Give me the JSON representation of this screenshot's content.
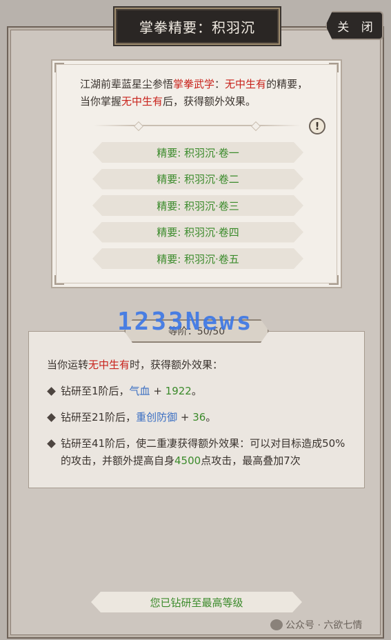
{
  "title": "掌拳精要：积羽沉",
  "close_label": "关 闭",
  "info": {
    "desc_prefix": "江湖前辈蓝星尘参悟",
    "desc_skill": "掌拳武学",
    "desc_colon": "：",
    "desc_move": "无中生有",
    "desc_mid": "的精要，当你掌握",
    "desc_move2": "无中生有",
    "desc_suffix": "后，获得额外效果。",
    "info_icon": "!",
    "volumes": [
      "精要: 积羽沉·卷一",
      "精要: 积羽沉·卷二",
      "精要: 积羽沉·卷三",
      "精要: 积羽沉·卷四",
      "精要: 积羽沉·卷五"
    ]
  },
  "level": {
    "badge": "等阶：50/50",
    "intro_prefix": "当你运转",
    "intro_move": "无中生有",
    "intro_suffix": "时，获得额外效果：",
    "effects": [
      {
        "prefix": "钻研至1阶后，",
        "stat": "气血",
        "sep": " + ",
        "value": "1922",
        "end": "。"
      },
      {
        "prefix": "钻研至21阶后，",
        "stat": "重创防御",
        "sep": " + ",
        "value": "36",
        "end": "。"
      },
      {
        "prefix": "钻研至41阶后，使二重凄获得额外效果：可以对目标造成50%的攻击，并额外提高自身",
        "value": "4500",
        "end": "点攻击，最高叠加7次"
      }
    ]
  },
  "watermark": "1233News",
  "max_label": "您已钻研至最高等级",
  "footer": "公众号 · 六欲七情",
  "colors": {
    "highlight_red": "#c8231c",
    "stat_blue": "#3b6fc2",
    "value_green": "#3a8a2a"
  }
}
